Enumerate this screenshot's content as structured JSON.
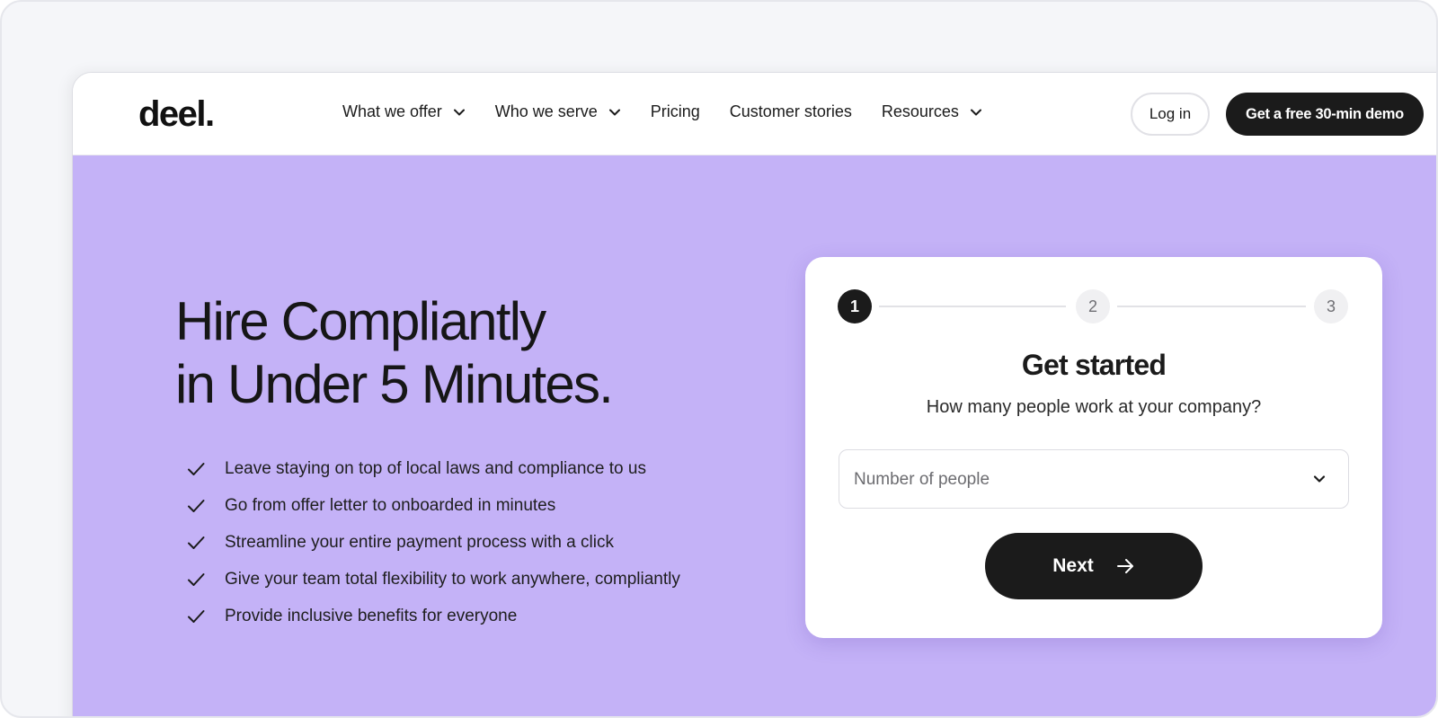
{
  "brand": {
    "logo": "deel."
  },
  "nav": {
    "items": [
      {
        "label": "What we offer",
        "has_dropdown": true
      },
      {
        "label": "Who we serve",
        "has_dropdown": true
      },
      {
        "label": "Pricing",
        "has_dropdown": false
      },
      {
        "label": "Customer stories",
        "has_dropdown": false
      },
      {
        "label": "Resources",
        "has_dropdown": true
      }
    ],
    "login_label": "Log in",
    "demo_label": "Get a free 30-min demo"
  },
  "hero": {
    "headline_line1": "Hire Compliantly",
    "headline_line2": "in Under 5 Minutes.",
    "bullets": [
      "Leave staying on top of local laws and compliance to us",
      "Go from offer letter to onboarded in minutes",
      "Streamline your entire payment process with a click",
      "Give your team total flexibility to work anywhere, compliantly",
      "Provide inclusive benefits for everyone"
    ],
    "background_color": "#c4b2f7"
  },
  "form": {
    "steps": [
      "1",
      "2",
      "3"
    ],
    "active_step": 1,
    "title": "Get started",
    "question": "How many people work at your company?",
    "select_placeholder": "Number of people",
    "next_label": "Next"
  },
  "colors": {
    "accent_dark": "#1b1b1b",
    "hero_purple": "#c4b2f7"
  },
  "icons": {
    "dropdown": "chevron-down-icon",
    "bullet": "check-icon",
    "next": "arrow-right-icon"
  }
}
